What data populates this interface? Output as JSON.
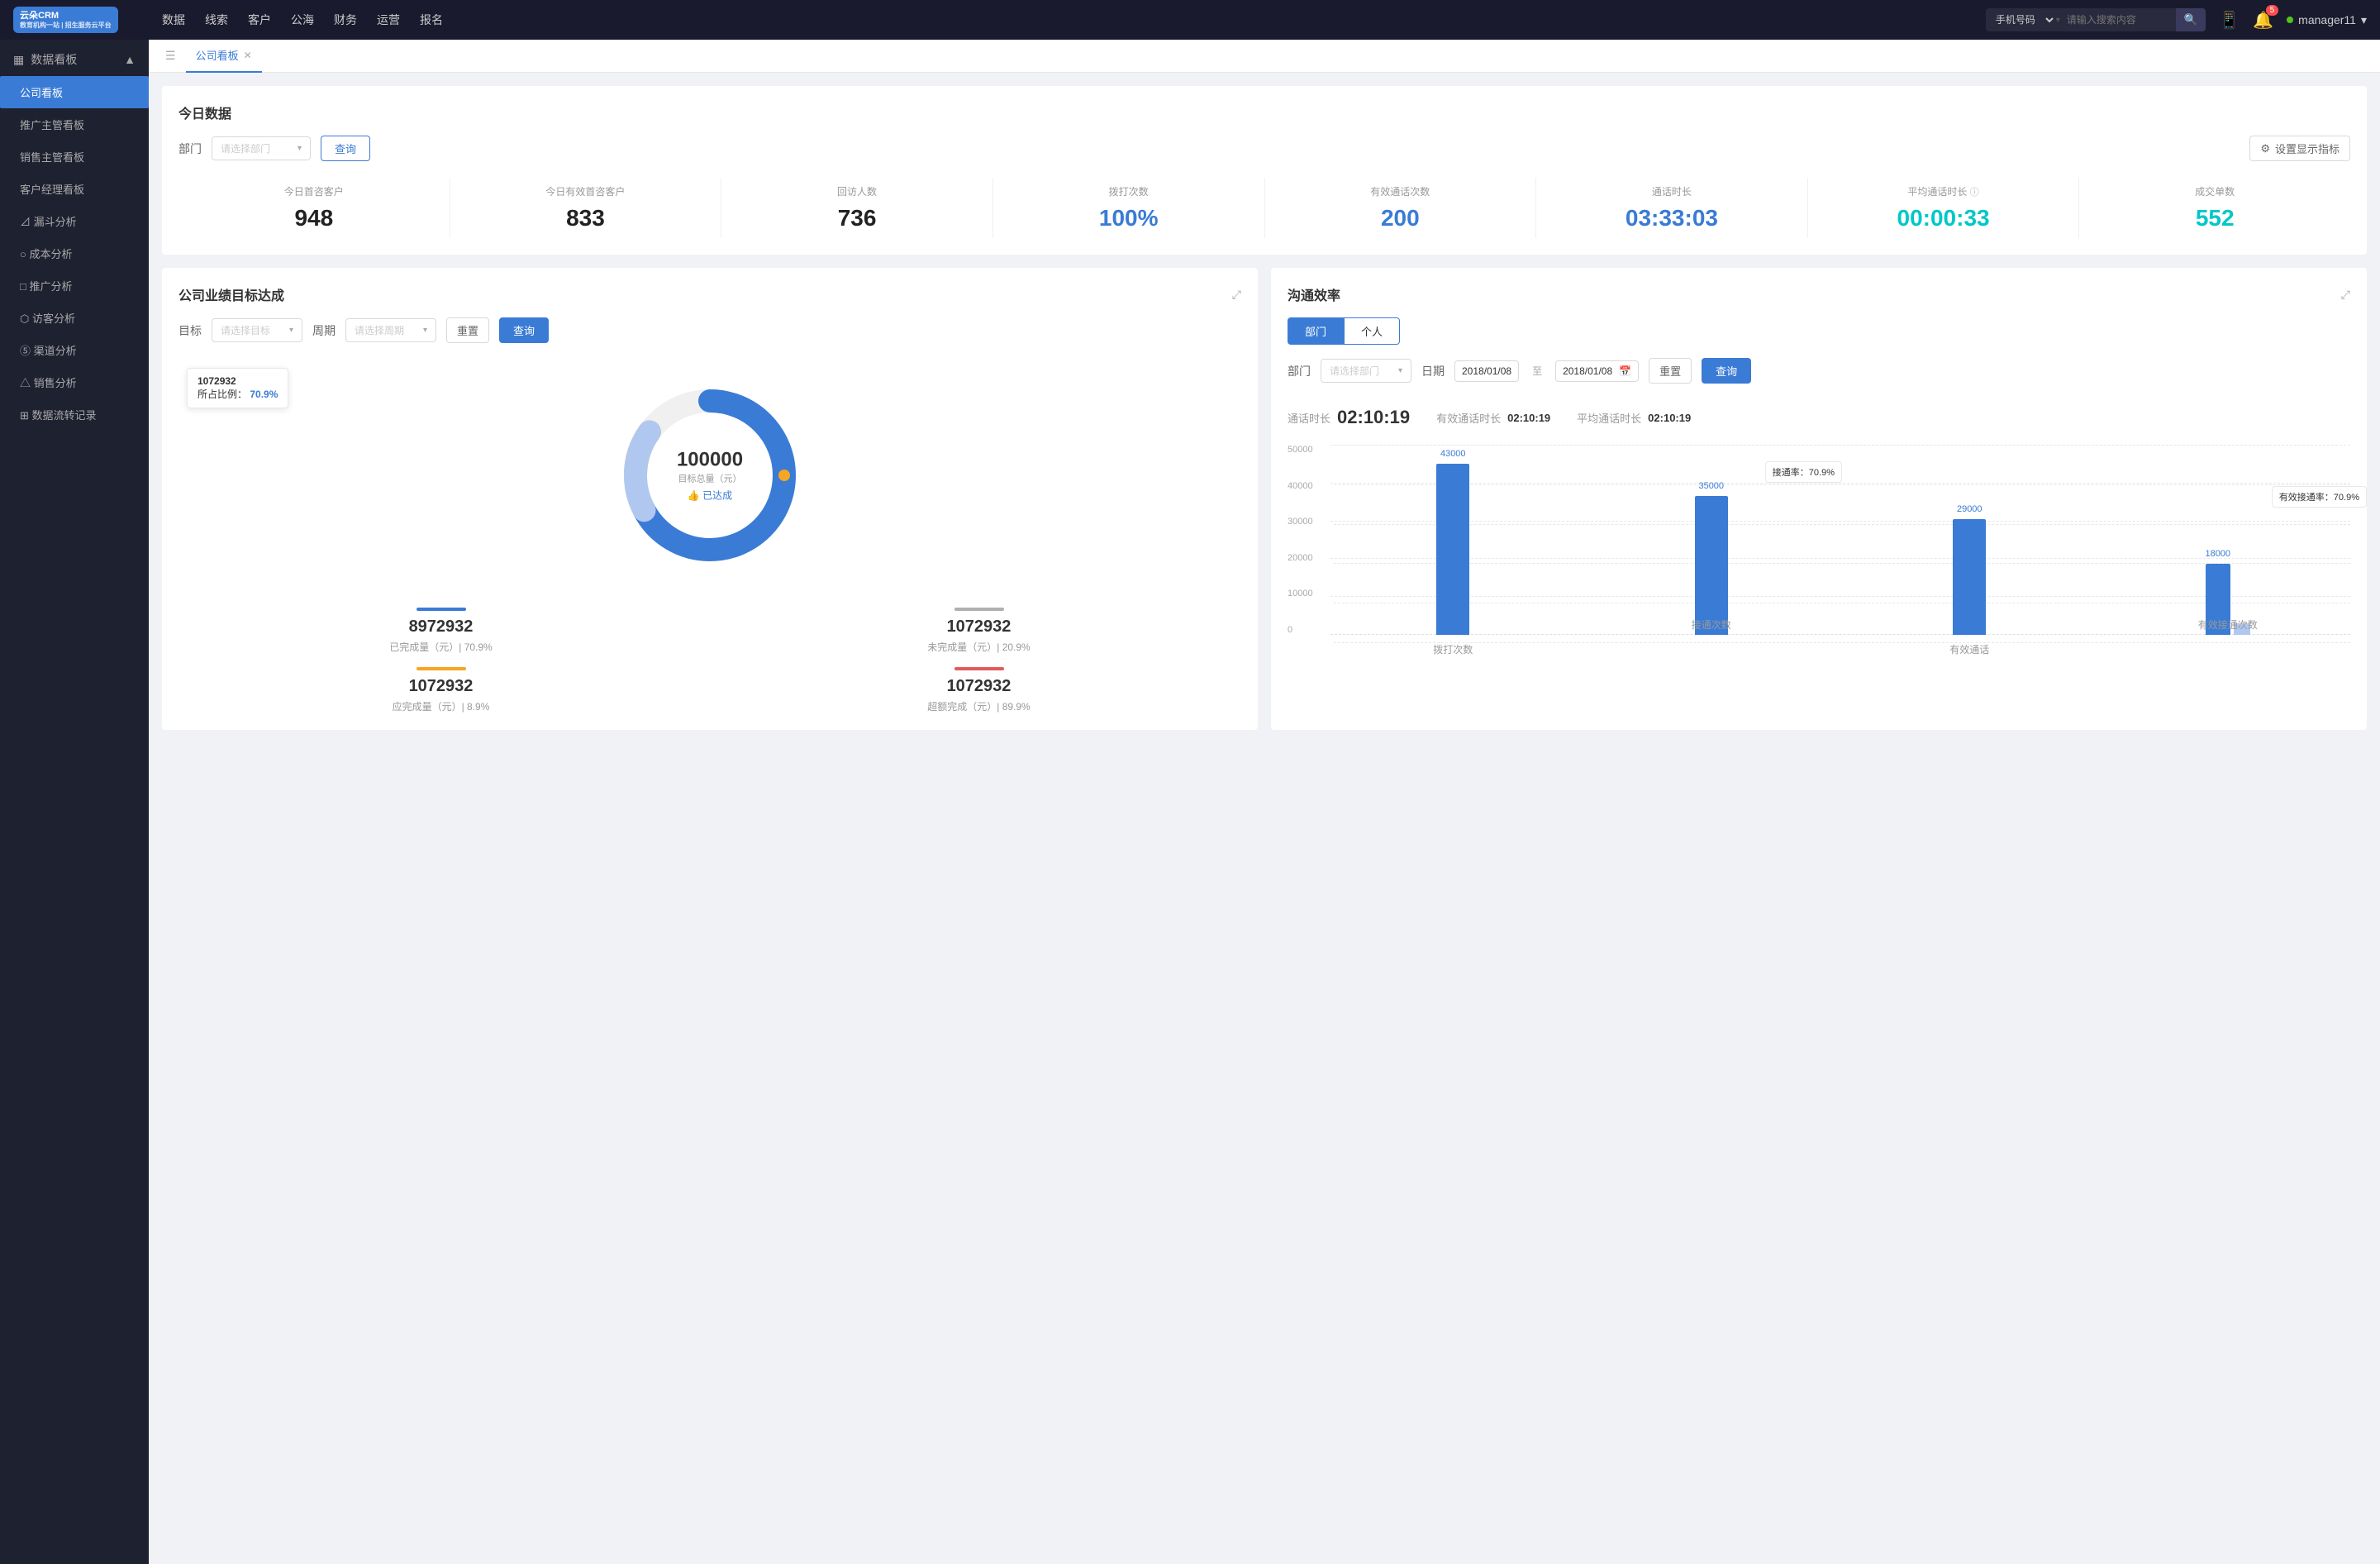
{
  "app": {
    "logo_line1": "云朵CRM",
    "logo_line2": "教育机构一站 | 招生服务云平台"
  },
  "topnav": {
    "items": [
      "数据",
      "线索",
      "客户",
      "公海",
      "财务",
      "运营",
      "报名"
    ],
    "search_placeholder": "请输入搜索内容",
    "search_select": "手机号码",
    "user": "manager11",
    "notification_count": "5"
  },
  "sidebar": {
    "section_label": "数据看板",
    "items": [
      {
        "label": "公司看板",
        "active": true,
        "icon": "📊"
      },
      {
        "label": "推广主管看板",
        "active": false,
        "icon": ""
      },
      {
        "label": "销售主管看板",
        "active": false,
        "icon": ""
      },
      {
        "label": "客户经理看板",
        "active": false,
        "icon": ""
      },
      {
        "label": "漏斗分析",
        "active": false,
        "icon": "⊿"
      },
      {
        "label": "成本分析",
        "active": false,
        "icon": "○"
      },
      {
        "label": "推广分析",
        "active": false,
        "icon": "□"
      },
      {
        "label": "访客分析",
        "active": false,
        "icon": "⬡"
      },
      {
        "label": "渠道分析",
        "active": false,
        "icon": "⑤"
      },
      {
        "label": "销售分析",
        "active": false,
        "icon": "△"
      },
      {
        "label": "数据流转记录",
        "active": false,
        "icon": "⊞"
      }
    ]
  },
  "tabs": {
    "items": [
      {
        "label": "公司看板",
        "active": true
      }
    ]
  },
  "today_section": {
    "title": "今日数据",
    "dept_label": "部门",
    "dept_placeholder": "请选择部门",
    "query_btn": "查询",
    "settings_btn": "设置显示指标",
    "stats": [
      {
        "label": "今日首咨客户",
        "value": "948",
        "color": "dark"
      },
      {
        "label": "今日有效首咨客户",
        "value": "833",
        "color": "dark"
      },
      {
        "label": "回访人数",
        "value": "736",
        "color": "dark"
      },
      {
        "label": "拨打次数",
        "value": "100%",
        "color": "blue"
      },
      {
        "label": "有效通话次数",
        "value": "200",
        "color": "blue"
      },
      {
        "label": "通话时长",
        "value": "03:33:03",
        "color": "blue"
      },
      {
        "label": "平均通话时长",
        "value": "00:00:33",
        "color": "cyan"
      },
      {
        "label": "成交单数",
        "value": "552",
        "color": "cyan"
      }
    ]
  },
  "goal_section": {
    "title": "公司业绩目标达成",
    "goal_label": "目标",
    "goal_placeholder": "请选择目标",
    "period_label": "周期",
    "period_placeholder": "请选择周期",
    "reset_btn": "重置",
    "query_btn": "查询",
    "donut": {
      "center_value": "100000",
      "center_sublabel": "目标总量（元）",
      "achievement": "👍 已达成",
      "tooltip_value": "1072932",
      "tooltip_ratio_label": "所占比例：",
      "tooltip_ratio": "70.9%",
      "completed_pct": 70.9,
      "over_pct": 8.9
    },
    "stat_cards": [
      {
        "label": "已完成量（元）| 70.9%",
        "value": "8972932",
        "color": "#3a7bd5",
        "bar_color": "#3a7bd5"
      },
      {
        "label": "未完成量（元）| 20.9%",
        "value": "1072932",
        "color": "#333",
        "bar_color": "#b0b0b0"
      },
      {
        "label": "应完成量（元）| 8.9%",
        "value": "1072932",
        "color": "#333",
        "bar_color": "#f5a623"
      },
      {
        "label": "超额完成（元）| 89.9%",
        "value": "1072932",
        "color": "#333",
        "bar_color": "#e05c5c"
      }
    ]
  },
  "comm_section": {
    "title": "沟通效率",
    "tab_dept": "部门",
    "tab_personal": "个人",
    "dept_label": "部门",
    "dept_placeholder": "请选择部门",
    "date_label": "日期",
    "date_from": "2018/01/08",
    "date_to": "2018/01/08",
    "reset_btn": "重置",
    "query_btn": "查询",
    "call_duration_label": "通话时长",
    "call_duration": "02:10:19",
    "effective_label": "有效通话时长",
    "effective_value": "02:10:19",
    "avg_label": "平均通话时长",
    "avg_value": "02:10:19",
    "chart": {
      "y_labels": [
        "50000",
        "40000",
        "30000",
        "20000",
        "10000",
        "0"
      ],
      "groups": [
        {
          "xlabel": "拨打次数",
          "bar1": 43000,
          "bar2": 0,
          "bar1_label": "43000",
          "annotation": ""
        },
        {
          "xlabel": "接通次数",
          "bar1": 35000,
          "bar2": 0,
          "bar1_label": "35000",
          "annotation": "接通率：70.9%"
        },
        {
          "xlabel": "有效通话",
          "bar1": 29000,
          "bar2": 0,
          "bar1_label": "29000",
          "annotation": ""
        },
        {
          "xlabel": "有效接通次数",
          "bar1": 18000,
          "bar2": 2000,
          "bar1_label": "18000",
          "annotation": "有效接通率：70.9%"
        }
      ]
    }
  }
}
